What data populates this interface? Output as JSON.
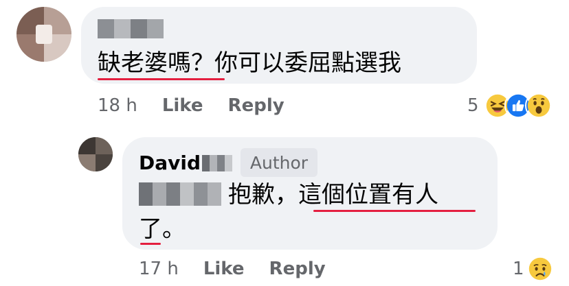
{
  "comment": {
    "author_name_blurred": true,
    "text_part1": "缺老婆嗎",
    "text_part2": "？你可以委屈點選我",
    "time": "18 h",
    "like_label": "Like",
    "reply_label": "Reply",
    "reaction_count": "5",
    "reactions": [
      "laughing-emoji",
      "like-emoji",
      "wow-emoji"
    ]
  },
  "reply": {
    "author_name": "David",
    "author_badge": "Author",
    "mention_blurred": true,
    "text_line1_part1": "抱歉，",
    "text_line1_part2": "這個位置有人",
    "text_line2_part1": "了",
    "text_line2_part2": "。",
    "time": "17 h",
    "like_label": "Like",
    "reply_label": "Reply",
    "reaction_count": "1",
    "reactions": [
      "sad-emoji"
    ]
  },
  "colors": {
    "bubble": "#f0f2f5",
    "secondary_text": "#65676b",
    "underline": "#e41e3f",
    "like_blue": "#1877f2"
  }
}
